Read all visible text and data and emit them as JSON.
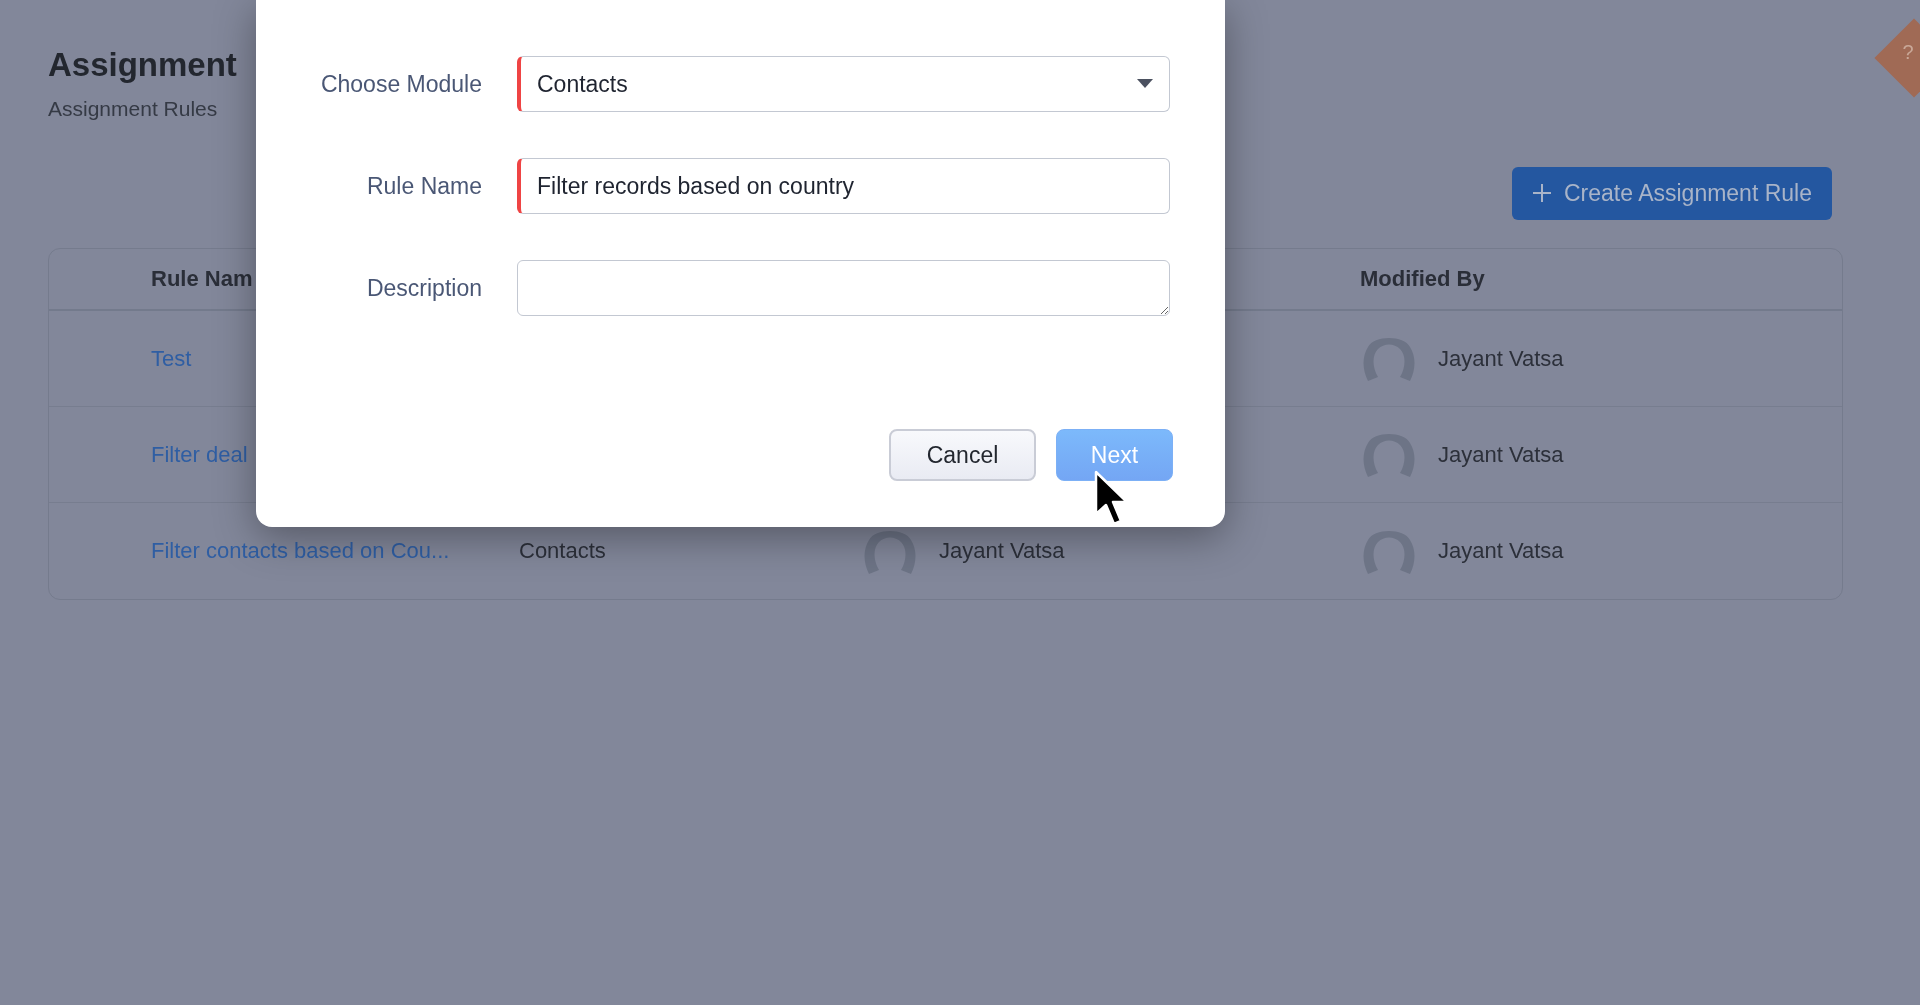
{
  "page": {
    "title": "Assignment",
    "subtitle": "Assignment Rules",
    "create_button": "Create Assignment Rule",
    "help": "?"
  },
  "table": {
    "columns": [
      {
        "label": "Rule Nam"
      },
      {},
      {},
      {
        "label": "Modified By"
      }
    ],
    "rows": [
      {
        "rule_name": "Test",
        "modified_by": "Jayant Vatsa"
      },
      {
        "rule_name": "Filter deal",
        "modified_by": "Jayant Vatsa"
      },
      {
        "rule_name": "Filter contacts based on Cou...",
        "module": "Contacts",
        "created_by": "Jayant Vatsa",
        "modified_by": "Jayant Vatsa"
      }
    ]
  },
  "dialog": {
    "fields": [
      {
        "label": "Choose Module",
        "kind": "select",
        "value": "Contacts",
        "required": true
      },
      {
        "label": "Rule Name",
        "kind": "text",
        "value": "Filter records based on country",
        "required": true
      },
      {
        "label": "Description",
        "kind": "textarea",
        "required": false
      }
    ],
    "buttons": [
      {
        "label": "Cancel",
        "kind": "secondary"
      },
      {
        "label": "Next",
        "kind": "primary"
      }
    ]
  }
}
